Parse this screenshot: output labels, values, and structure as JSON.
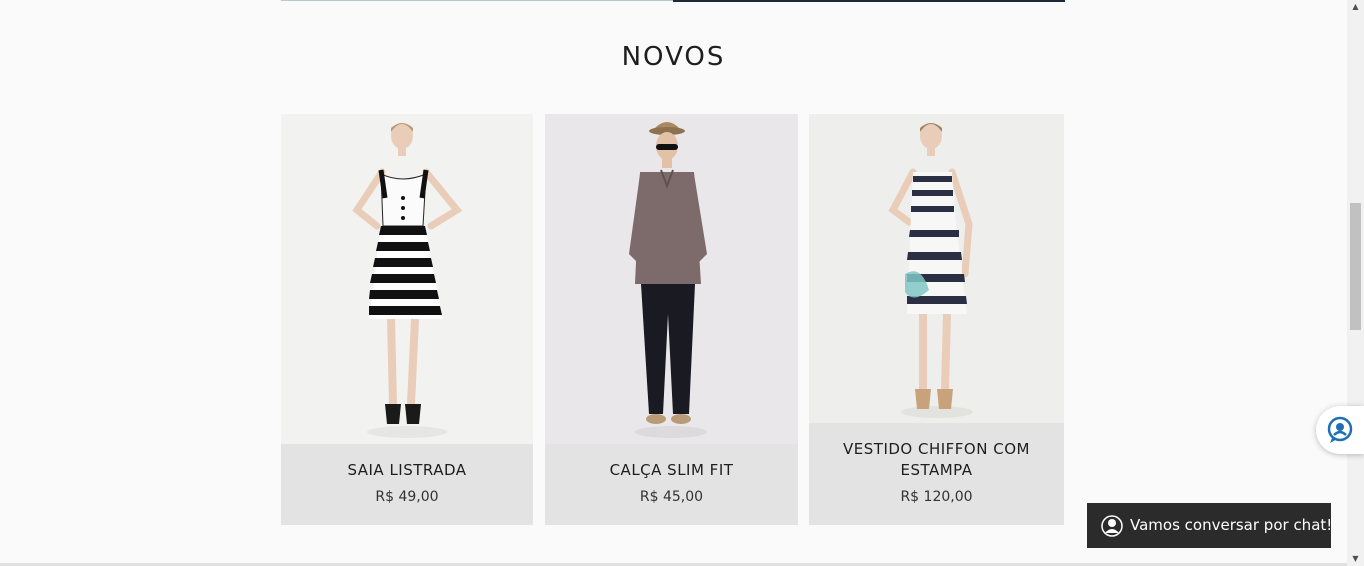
{
  "section": {
    "title": "NOVOS"
  },
  "products": [
    {
      "name": "SAIA LISTRADA",
      "price": "R$ 49,00"
    },
    {
      "name": "CALÇA SLIM FIT",
      "price": "R$ 45,00"
    },
    {
      "name": "VESTIDO CHIFFON COM ESTAMPA",
      "price": "R$ 120,00"
    }
  ],
  "chat": {
    "label": "Vamos conversar por chat!"
  },
  "colors": {
    "card_bg": "#e4e3e3",
    "chat_bar_bg": "#2b2b2b",
    "accent_blue": "#1f6fb5"
  }
}
